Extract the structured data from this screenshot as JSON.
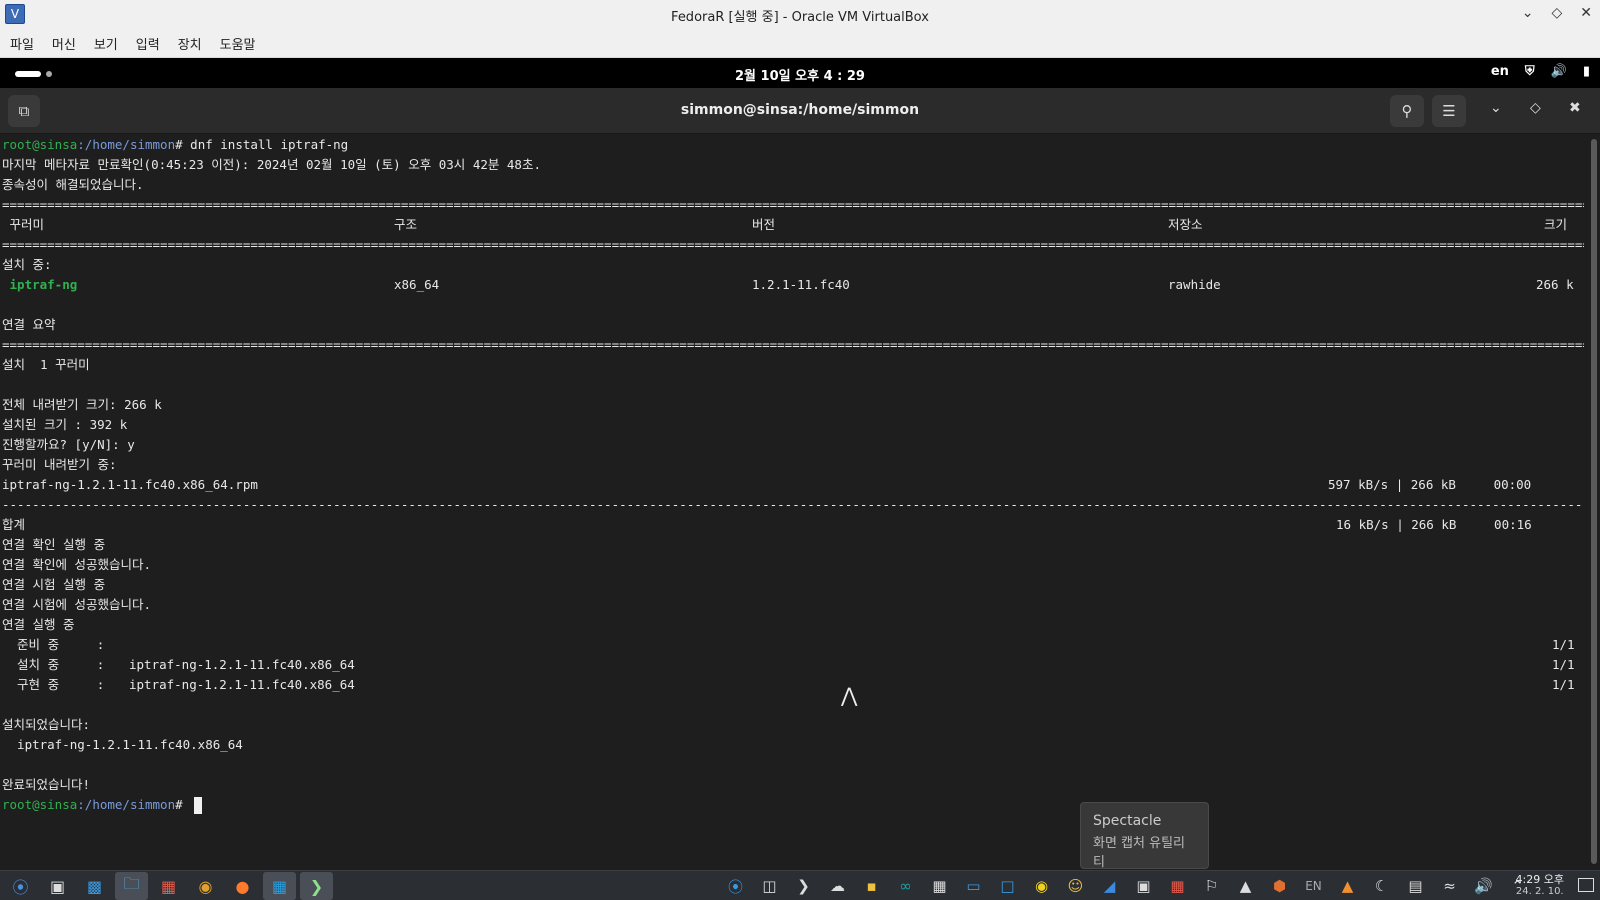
{
  "host_window": {
    "title": "FedoraR [실행 중] - Oracle VM VirtualBox",
    "menu": [
      "파일",
      "머신",
      "보기",
      "입력",
      "장치",
      "도움말"
    ]
  },
  "guest_panel": {
    "clock": "2월 10일 오후 4 : 29",
    "lang": "en"
  },
  "terminal": {
    "title": "simmon@sinsa:/home/simmon",
    "prompt_user": "root@sinsa",
    "prompt_path": ":/home/simmon",
    "prompt_symbol": "# ",
    "command": "dnf install iptraf-ng",
    "line_meta": "마지막 메타자료 만료확인(0:45:23 이전): 2024년 02월 10일 (토) 오후 03시 42분 48초.",
    "line_deps": "종속성이 해결되었습니다.",
    "table_headers": {
      "package": " 꾸러미",
      "arch": "구조",
      "version": "버전",
      "repo": "저장소",
      "size": "크기"
    },
    "installing_label": "설치 중:",
    "package_row": {
      "name": " iptraf-ng",
      "arch": "x86_64",
      "version": "1.2.1-11.fc40",
      "repo": "rawhide",
      "size": "266 k"
    },
    "summary_label": "연결 요약",
    "install_count": "설치  1 꾸러미",
    "total_download": "전체 내려받기 크기: 266 k",
    "installed_size": "설치된 크기 : 392 k",
    "proceed_prompt": "진행할까요? [y/N]: y",
    "downloading_label": "꾸러미 내려받기 중:",
    "rpm_file": "iptraf-ng-1.2.1-11.fc40.x86_64.rpm",
    "rpm_stats": "597 kB/s | 266 kB     00:00",
    "total_label": "합계",
    "total_stats": "16 kB/s | 266 kB     00:16",
    "trans_check": "연결 확인 실행 중",
    "trans_check_ok": "연결 확인에 성공했습니다.",
    "trans_test": "연결 시험 실행 중",
    "trans_test_ok": "연결 시험에 성공했습니다.",
    "trans_run": "연결 실행 중",
    "steps": [
      {
        "label": "  준비 중     :",
        "pkg": "",
        "count": "1/1"
      },
      {
        "label": "  설치 중     :",
        "pkg": "iptraf-ng-1.2.1-11.fc40.x86_64",
        "count": "1/1"
      },
      {
        "label": "  구현 중     :",
        "pkg": "iptraf-ng-1.2.1-11.fc40.x86_64",
        "count": "1/1"
      }
    ],
    "installed_label": "설치되었습니다:",
    "installed_pkg": "  iptraf-ng-1.2.1-11.fc40.x86_64",
    "done": "완료되었습니다!"
  },
  "tooltip": {
    "title": "Spectacle",
    "subtitle": "화면 캡처 유틸리티"
  },
  "taskbar": {
    "lang": "EN",
    "time": "4:29 오후",
    "date": "24. 2. 10."
  }
}
